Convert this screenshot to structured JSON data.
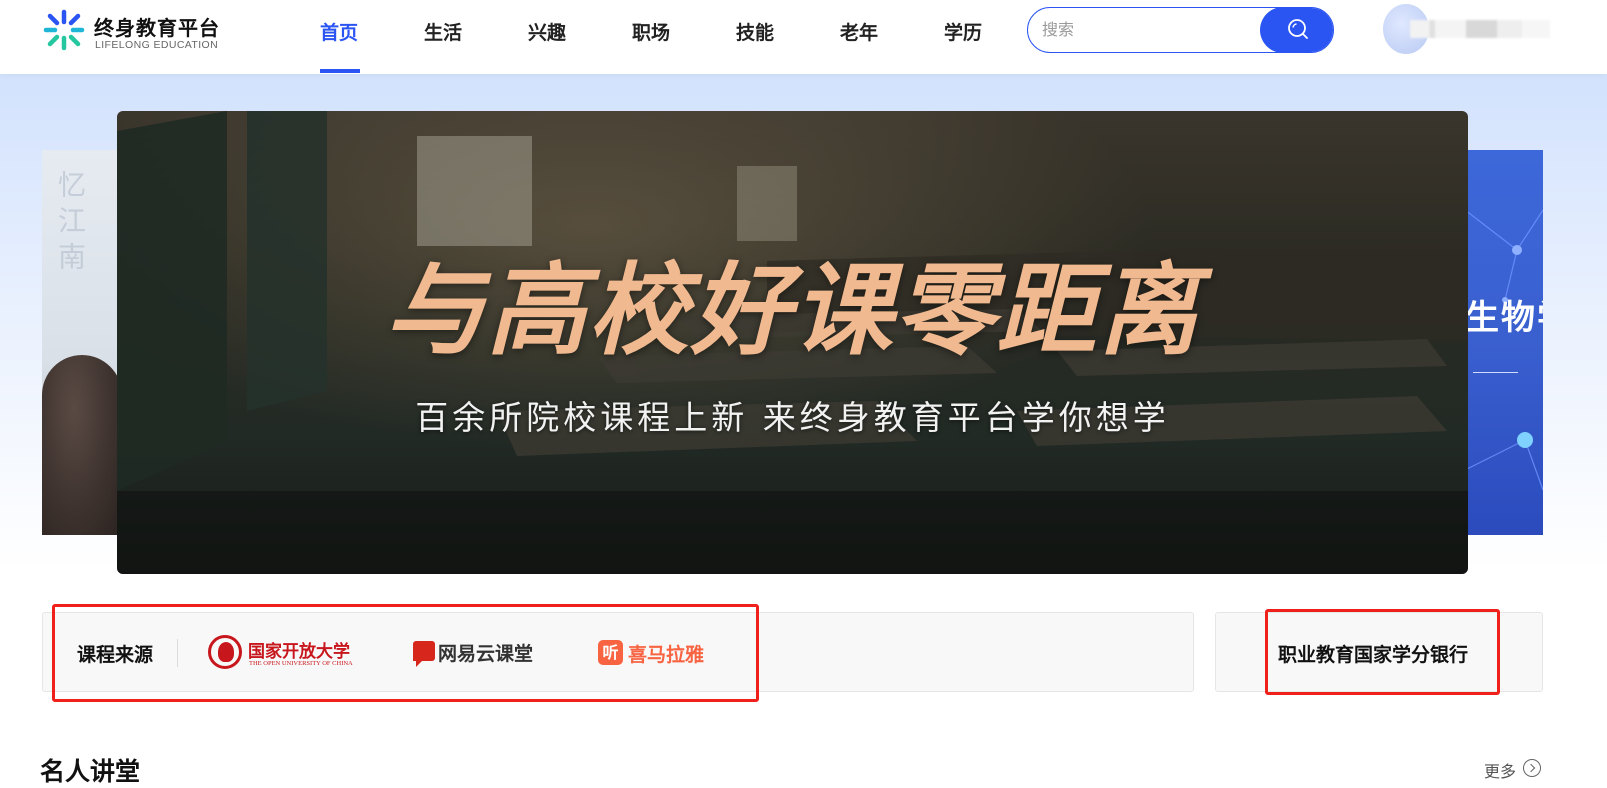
{
  "header": {
    "logo_cn": "终身教育平台",
    "logo_en": "LIFELONG EDUCATION",
    "nav": [
      {
        "label": "首页",
        "active": true
      },
      {
        "label": "生活",
        "active": false
      },
      {
        "label": "兴趣",
        "active": false
      },
      {
        "label": "职场",
        "active": false
      },
      {
        "label": "技能",
        "active": false
      },
      {
        "label": "老年",
        "active": false
      },
      {
        "label": "学历",
        "active": false
      }
    ],
    "search": {
      "placeholder": "搜索",
      "value": "",
      "icon": "search-icon"
    },
    "accent_color": "#2a55f3"
  },
  "banner": {
    "title": "与高校好课零距离",
    "subtitle": "百余所院校课程上新 来终身教育平台学你想学",
    "side_right_text": "生物学"
  },
  "sources": {
    "label": "课程来源",
    "items": [
      {
        "name": "国家开放大学",
        "sub": "THE OPEN UNIVERSITY OF CHINA"
      },
      {
        "name": "网易云课堂"
      },
      {
        "name": "喜马拉雅",
        "mark": "听"
      }
    ]
  },
  "credit_bank": {
    "label": "职业教育国家学分银行"
  },
  "section": {
    "title": "名人讲堂",
    "more": "更多"
  }
}
